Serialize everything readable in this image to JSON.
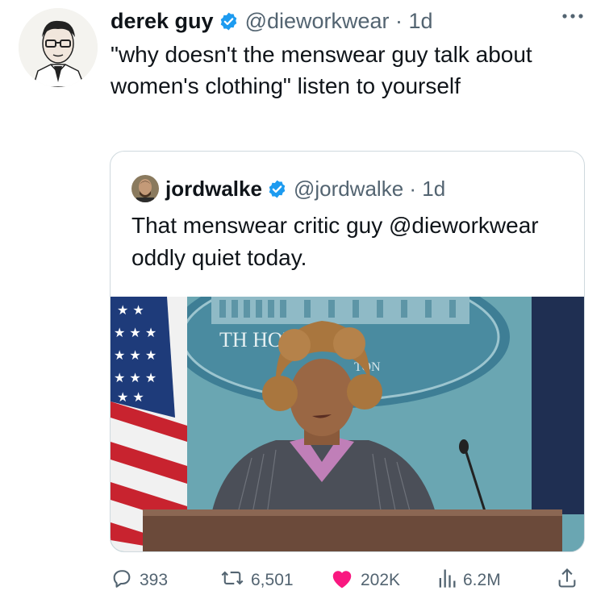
{
  "tweet": {
    "author_name": "derek guy",
    "handle": "@dieworkwear",
    "time": "1d",
    "text": "\"why doesn't the menswear guy talk about women's clothing\" listen to yourself"
  },
  "quoted": {
    "author_name": "jordwalke",
    "handle": "@jordwalke",
    "time": "1d",
    "text": "That menswear critic guy @dieworkwear oddly quiet today.",
    "media_sign_text": "TH HOUSE",
    "media_sign_subtext": "TON"
  },
  "actions": {
    "replies": "393",
    "retweets": "6,501",
    "likes": "202K",
    "views": "6.2M"
  },
  "colors": {
    "verified": "#1d9bf0",
    "like": "#f91880",
    "secondary_text": "#536471",
    "border": "#cfd9de"
  },
  "icons": [
    "more-icon",
    "verified-icon",
    "reply-icon",
    "retweet-icon",
    "heart-icon",
    "views-icon",
    "share-icon"
  ]
}
